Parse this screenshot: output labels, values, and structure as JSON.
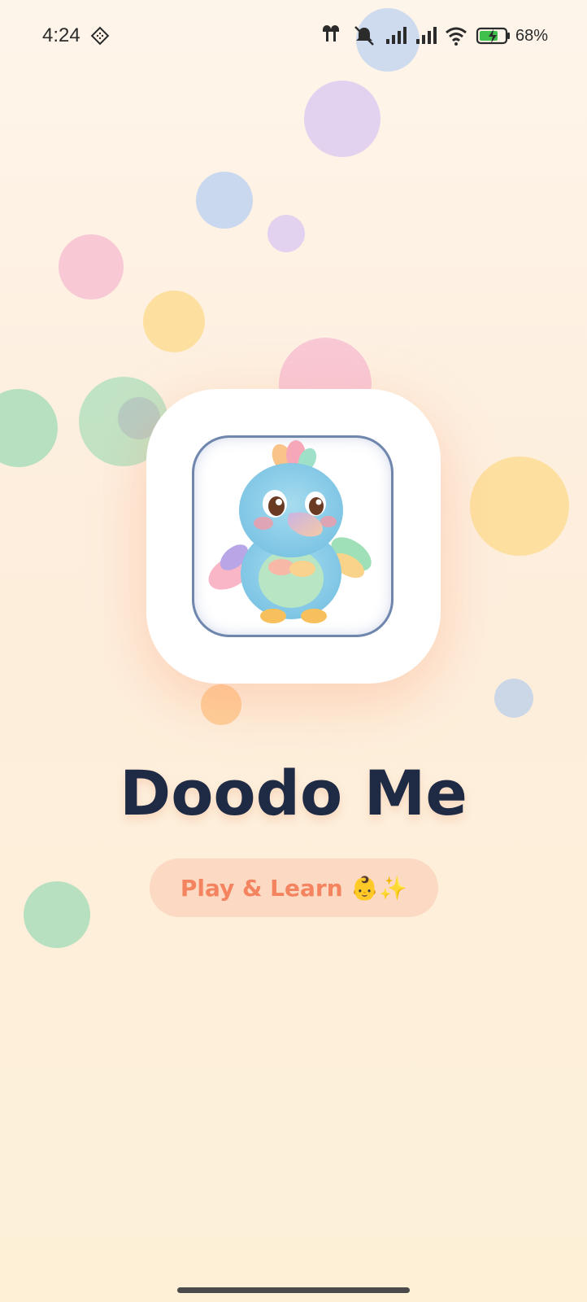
{
  "status_bar": {
    "time": "4:24",
    "battery_percent": "68%",
    "icons": [
      "nfc-icon",
      "earbuds-icon",
      "silent-bell-icon",
      "signal-icon",
      "signal-icon",
      "wifi-icon",
      "battery-charging-icon"
    ]
  },
  "app": {
    "title": "Doodo Me",
    "tagline": "Play & Learn 👶✨",
    "mascot": "baby-dodo-bird-image"
  },
  "colors": {
    "title": "#1f2a44",
    "tagline_text": "#f4845f",
    "tagline_bg": "#fcd9c3",
    "bubble_blue": "#c9d8ef",
    "bubble_purple": "#e2d2ef",
    "bubble_pink": "#f8c8d5",
    "bubble_yellow": "#fde0a0",
    "bubble_green": "#b6e0c0",
    "bubble_orange": "#fdcf9a"
  }
}
